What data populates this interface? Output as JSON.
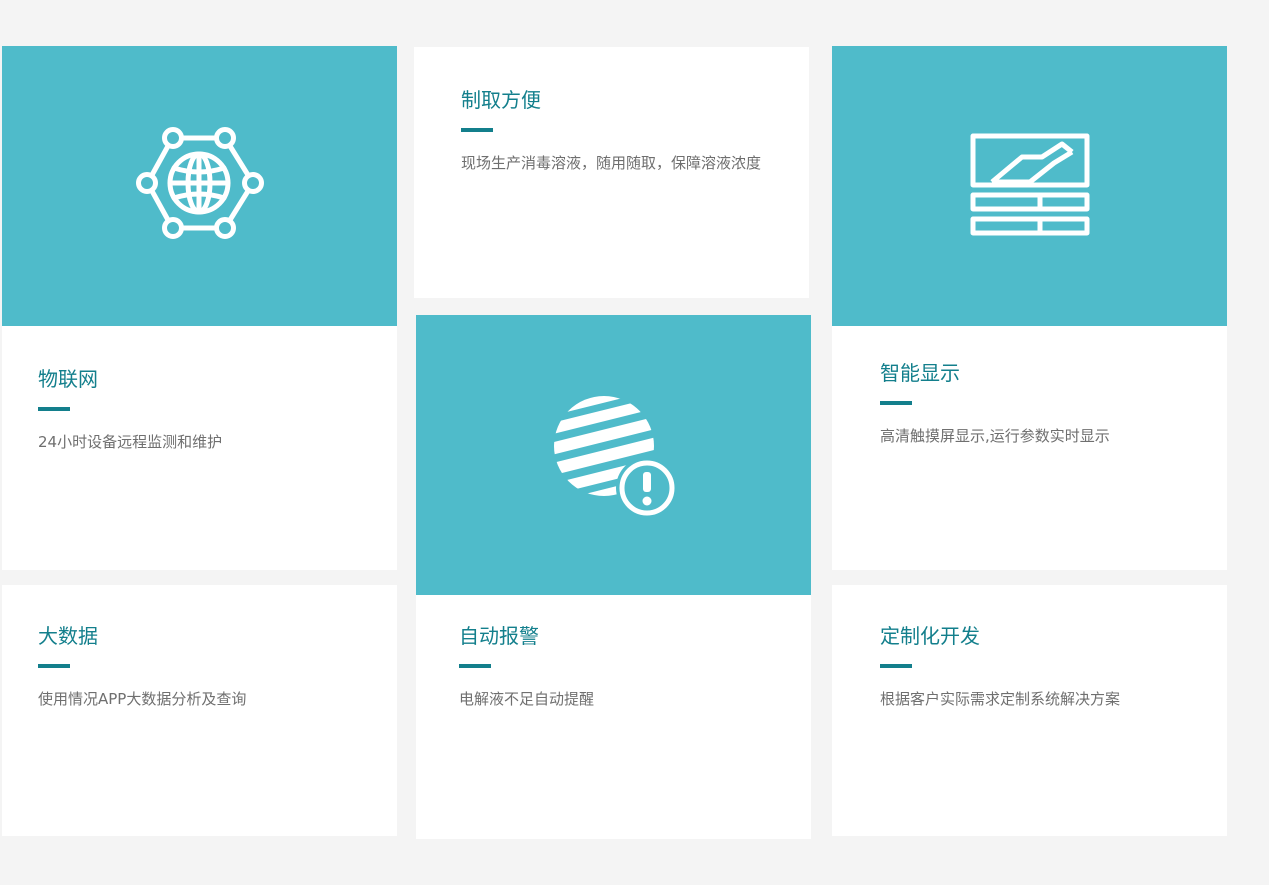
{
  "features": {
    "iot": {
      "title": "物联网",
      "desc": "24小时设备远程监测和维护",
      "icon": "globe-network-icon"
    },
    "convenient": {
      "title": "制取方便",
      "desc": "现场生产消毒溶液，随用随取，保障溶液浓度"
    },
    "display": {
      "title": "智能显示",
      "desc": "高清触摸屏显示,运行参数实时显示",
      "icon": "display-screen-icon"
    },
    "alarm": {
      "title": "自动报警",
      "desc": "电解液不足自动提醒",
      "icon": "globe-alert-icon"
    },
    "bigdata": {
      "title": "大数据",
      "desc": "使用情况APP大数据分析及查询"
    },
    "custom": {
      "title": "定制化开发",
      "desc": "根据客户实际需求定制系统解决方案"
    }
  },
  "colors": {
    "background": "#f4f4f4",
    "card": "#ffffff",
    "accent_panel": "#4fbbca",
    "title": "#137f8c",
    "text": "#6f6f6f"
  }
}
